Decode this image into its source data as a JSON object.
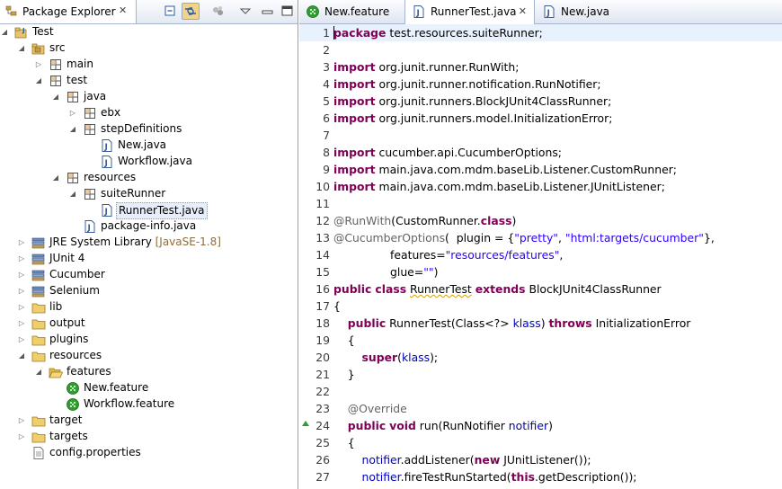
{
  "package_explorer": {
    "title": "Package Explorer",
    "close_glyph": "✕",
    "tree": [
      {
        "label": "Test",
        "icon": "java-project-icon",
        "twisty": "expanded"
      },
      {
        "label": "src",
        "icon": "source-folder-icon",
        "twisty": "expanded"
      },
      {
        "label": "main",
        "icon": "package-icon",
        "twisty": "collapsed"
      },
      {
        "label": "test",
        "icon": "package-icon",
        "twisty": "expanded"
      },
      {
        "label": "java",
        "icon": "package-icon",
        "twisty": "expanded"
      },
      {
        "label": "ebx",
        "icon": "package-icon",
        "twisty": "collapsed"
      },
      {
        "label": "stepDefinitions",
        "icon": "package-icon",
        "twisty": "expanded"
      },
      {
        "label": "New.java",
        "icon": "java-file-icon",
        "twisty": "none"
      },
      {
        "label": "Workflow.java",
        "icon": "java-file-icon",
        "twisty": "none"
      },
      {
        "label": "resources",
        "icon": "package-icon",
        "twisty": "expanded"
      },
      {
        "label": "suiteRunner",
        "icon": "package-icon",
        "twisty": "expanded"
      },
      {
        "label": "RunnerTest.java",
        "icon": "java-file-icon",
        "twisty": "none",
        "selected": true
      },
      {
        "label": "package-info.java",
        "icon": "java-file-icon",
        "twisty": "none"
      },
      {
        "label": "JRE System Library",
        "decoration": "[JavaSE-1.8]",
        "icon": "library-icon",
        "twisty": "collapsed"
      },
      {
        "label": "JUnit 4",
        "icon": "library-icon",
        "twisty": "collapsed"
      },
      {
        "label": "Cucumber",
        "icon": "library-icon",
        "twisty": "collapsed"
      },
      {
        "label": "Selenium",
        "icon": "library-icon",
        "twisty": "collapsed"
      },
      {
        "label": "lib",
        "icon": "folder-icon",
        "twisty": "collapsed"
      },
      {
        "label": "output",
        "icon": "folder-icon",
        "twisty": "collapsed"
      },
      {
        "label": "plugins",
        "icon": "folder-icon",
        "twisty": "collapsed"
      },
      {
        "label": "resources",
        "icon": "folder-icon",
        "twisty": "expanded"
      },
      {
        "label": "features",
        "icon": "folder-open-icon",
        "twisty": "expanded"
      },
      {
        "label": "New.feature",
        "icon": "cucumber-icon",
        "twisty": "none"
      },
      {
        "label": "Workflow.feature",
        "icon": "cucumber-icon",
        "twisty": "none"
      },
      {
        "label": "target",
        "icon": "folder-icon",
        "twisty": "collapsed"
      },
      {
        "label": "targets",
        "icon": "folder-icon",
        "twisty": "collapsed"
      },
      {
        "label": "config.properties",
        "icon": "properties-file-icon",
        "twisty": "none"
      }
    ]
  },
  "editor": {
    "tabs": [
      {
        "label": "New.feature",
        "icon": "cucumber-icon",
        "active": false
      },
      {
        "label": "RunnerTest.java",
        "icon": "java-file-icon",
        "active": true,
        "close": "✕"
      },
      {
        "label": "New.java",
        "icon": "java-file-icon",
        "active": false
      }
    ],
    "current_line": 1,
    "lines": [
      {
        "n": "1",
        "tokens": [
          [
            "kw",
            "package"
          ],
          [
            "t",
            " test.resources.suiteRunner;"
          ]
        ]
      },
      {
        "n": "2",
        "tokens": []
      },
      {
        "n": "3",
        "tokens": [
          [
            "kw",
            "import"
          ],
          [
            "t",
            " org.junit.runner.RunWith;"
          ]
        ]
      },
      {
        "n": "4",
        "tokens": [
          [
            "kw",
            "import"
          ],
          [
            "t",
            " org.junit.runner.notification.RunNotifier;"
          ]
        ]
      },
      {
        "n": "5",
        "tokens": [
          [
            "kw",
            "import"
          ],
          [
            "t",
            " org.junit.runners.BlockJUnit4ClassRunner;"
          ]
        ]
      },
      {
        "n": "6",
        "tokens": [
          [
            "kw",
            "import"
          ],
          [
            "t",
            " org.junit.runners.model.InitializationError;"
          ]
        ]
      },
      {
        "n": "7",
        "tokens": []
      },
      {
        "n": "8",
        "tokens": [
          [
            "kw",
            "import"
          ],
          [
            "t",
            " cucumber.api.CucumberOptions;"
          ]
        ]
      },
      {
        "n": "9",
        "tokens": [
          [
            "kw",
            "import"
          ],
          [
            "t",
            " main.java.com.mdm.baseLib.Listener.CustomRunner;"
          ]
        ]
      },
      {
        "n": "10",
        "tokens": [
          [
            "kw",
            "import"
          ],
          [
            "t",
            " main.java.com.mdm.baseLib.Listener.JUnitListener;"
          ]
        ]
      },
      {
        "n": "11",
        "tokens": []
      },
      {
        "n": "12",
        "tokens": [
          [
            "ann",
            "@RunWith"
          ],
          [
            "t",
            "(CustomRunner."
          ],
          [
            "kw",
            "class"
          ],
          [
            "t",
            ")"
          ]
        ]
      },
      {
        "n": "13",
        "tokens": [
          [
            "ann",
            "@CucumberOptions"
          ],
          [
            "t",
            "(  plugin = {"
          ],
          [
            "str",
            "\"pretty\""
          ],
          [
            "t",
            ", "
          ],
          [
            "str",
            "\"html:targets/cucumber\""
          ],
          [
            "t",
            "},"
          ]
        ]
      },
      {
        "n": "14",
        "tokens": [
          [
            "t",
            "                features="
          ],
          [
            "str",
            "\"resources/features\""
          ],
          [
            "t",
            ","
          ]
        ]
      },
      {
        "n": "15",
        "tokens": [
          [
            "t",
            "                glue="
          ],
          [
            "str",
            "\"\""
          ],
          [
            "t",
            ")"
          ]
        ]
      },
      {
        "n": "16",
        "tokens": [
          [
            "kw",
            "public"
          ],
          [
            "t",
            " "
          ],
          [
            "kw",
            "class"
          ],
          [
            "t",
            " "
          ],
          [
            "ul",
            "RunnerTest"
          ],
          [
            "t",
            " "
          ],
          [
            "kw",
            "extends"
          ],
          [
            "t",
            " BlockJUnit4ClassRunner"
          ]
        ]
      },
      {
        "n": "17",
        "tokens": [
          [
            "t",
            "{"
          ]
        ]
      },
      {
        "n": "18",
        "tokens": [
          [
            "t",
            "    "
          ],
          [
            "kw",
            "public"
          ],
          [
            "t",
            " RunnerTest(Class<?> "
          ],
          [
            "fld",
            "klass"
          ],
          [
            "t",
            ") "
          ],
          [
            "kw",
            "throws"
          ],
          [
            "t",
            " InitializationError"
          ]
        ]
      },
      {
        "n": "19",
        "tokens": [
          [
            "t",
            "    {"
          ]
        ]
      },
      {
        "n": "20",
        "tokens": [
          [
            "t",
            "        "
          ],
          [
            "kw",
            "super"
          ],
          [
            "t",
            "("
          ],
          [
            "fld",
            "klass"
          ],
          [
            "t",
            ");"
          ]
        ]
      },
      {
        "n": "21",
        "tokens": [
          [
            "t",
            "    }"
          ]
        ]
      },
      {
        "n": "22",
        "tokens": []
      },
      {
        "n": "23",
        "tokens": [
          [
            "t",
            "    "
          ],
          [
            "ann",
            "@Override"
          ]
        ]
      },
      {
        "n": "24",
        "tokens": [
          [
            "t",
            "    "
          ],
          [
            "kw",
            "public"
          ],
          [
            "t",
            " "
          ],
          [
            "kw",
            "void"
          ],
          [
            "t",
            " run(RunNotifier "
          ],
          [
            "fld",
            "notifier"
          ],
          [
            "t",
            ")"
          ]
        ],
        "override_marker": true
      },
      {
        "n": "25",
        "tokens": [
          [
            "t",
            "    {"
          ]
        ]
      },
      {
        "n": "26",
        "tokens": [
          [
            "t",
            "        "
          ],
          [
            "fld",
            "notifier"
          ],
          [
            "t",
            ".addListener("
          ],
          [
            "kw",
            "new"
          ],
          [
            "t",
            " JUnitListener());"
          ]
        ]
      },
      {
        "n": "27",
        "tokens": [
          [
            "t",
            "        "
          ],
          [
            "fld",
            "notifier"
          ],
          [
            "t",
            ".fireTestRunStarted("
          ],
          [
            "kw",
            "this"
          ],
          [
            "t",
            ".getDescription());"
          ]
        ]
      }
    ]
  }
}
